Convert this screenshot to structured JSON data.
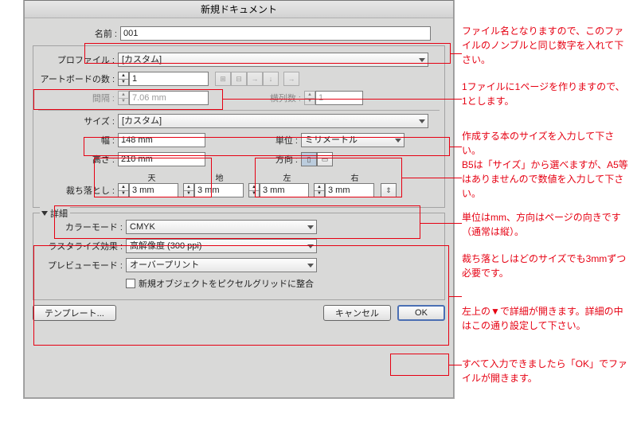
{
  "title": "新規ドキュメント",
  "name": {
    "label": "名前 :",
    "value": "001"
  },
  "profile": {
    "label": "プロファイル :",
    "value": "[カスタム]"
  },
  "artboards": {
    "label": "アートボードの数 :",
    "value": "1"
  },
  "gap": {
    "label": "間隔 :",
    "value": "7.06 mm"
  },
  "cols": {
    "label": "横列数 :",
    "value": "1"
  },
  "size": {
    "label": "サイズ :",
    "value": "[カスタム]"
  },
  "width": {
    "label": "幅 :",
    "value": "148 mm"
  },
  "height": {
    "label": "高さ :",
    "value": "210 mm"
  },
  "units": {
    "label": "単位 :",
    "value": "ミリメートル"
  },
  "orient": {
    "label": "方向 :"
  },
  "bleed": {
    "label": "裁ち落とし :",
    "top_h": "天",
    "bottom_h": "地",
    "left_h": "左",
    "right_h": "右",
    "top": "3 mm",
    "bottom": "3 mm",
    "left": "3 mm",
    "right": "3 mm"
  },
  "adv": {
    "label": "詳細",
    "colormode": {
      "label": "カラーモード :",
      "value": "CMYK"
    },
    "raster": {
      "label": "ラスタライズ効果 :",
      "value": "高解像度 (300 ppi)"
    },
    "preview": {
      "label": "プレビューモード :",
      "value": "オーバープリント"
    },
    "pixelgrid": "新規オブジェクトをピクセルグリッドに整合"
  },
  "btns": {
    "template": "テンプレート...",
    "cancel": "キャンセル",
    "ok": "OK"
  },
  "ann": {
    "a1": "ファイル名となりますので、このファイルのノンブルと同じ数字を入れて下さい。",
    "a2": "1ファイルに1ページを作りますので、1とします。",
    "a3": "作成する本のサイズを入力して下さい。\nB5は「サイズ」から選べますが、A5等はありませんので数値を入力して下さい。",
    "a4": "単位はmm、方向はページの向きです（通常は縦）。",
    "a5": "裁ち落としはどのサイズでも3mmずつ必要です。",
    "a6": "左上の▼で詳細が開きます。詳細の中はこの通り設定して下さい。",
    "a7": "すべて入力できましたら「OK」でファイルが開きます。"
  }
}
